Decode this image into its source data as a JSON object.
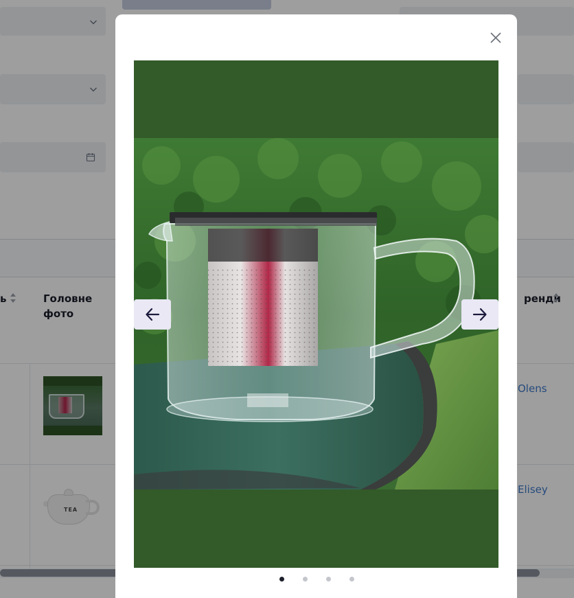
{
  "table": {
    "headers": [
      {
        "text": "ь",
        "sortable": true
      },
      {
        "text": "Головне фото",
        "sortable": false
      },
      {
        "text": "ренди",
        "sortable": true
      }
    ],
    "rows": [
      {
        "brand": "Olens",
        "photo": "glass-teapot-thumbnail"
      },
      {
        "brand": "Elisey",
        "photo": "white-teapot-thumbnail"
      }
    ],
    "thumb_label": "TEA"
  },
  "modal": {
    "slide_count": 4,
    "active_slide": 0,
    "prev_icon": "arrow-left-icon",
    "next_icon": "arrow-right-icon",
    "close_icon": "close-icon"
  },
  "colors": {
    "slide_background": "#335a29",
    "nav_button": "#e9e8f4",
    "dot_active": "#1d1f2b",
    "dot_inactive": "#c4c6cc",
    "link": "#3c78c8"
  }
}
